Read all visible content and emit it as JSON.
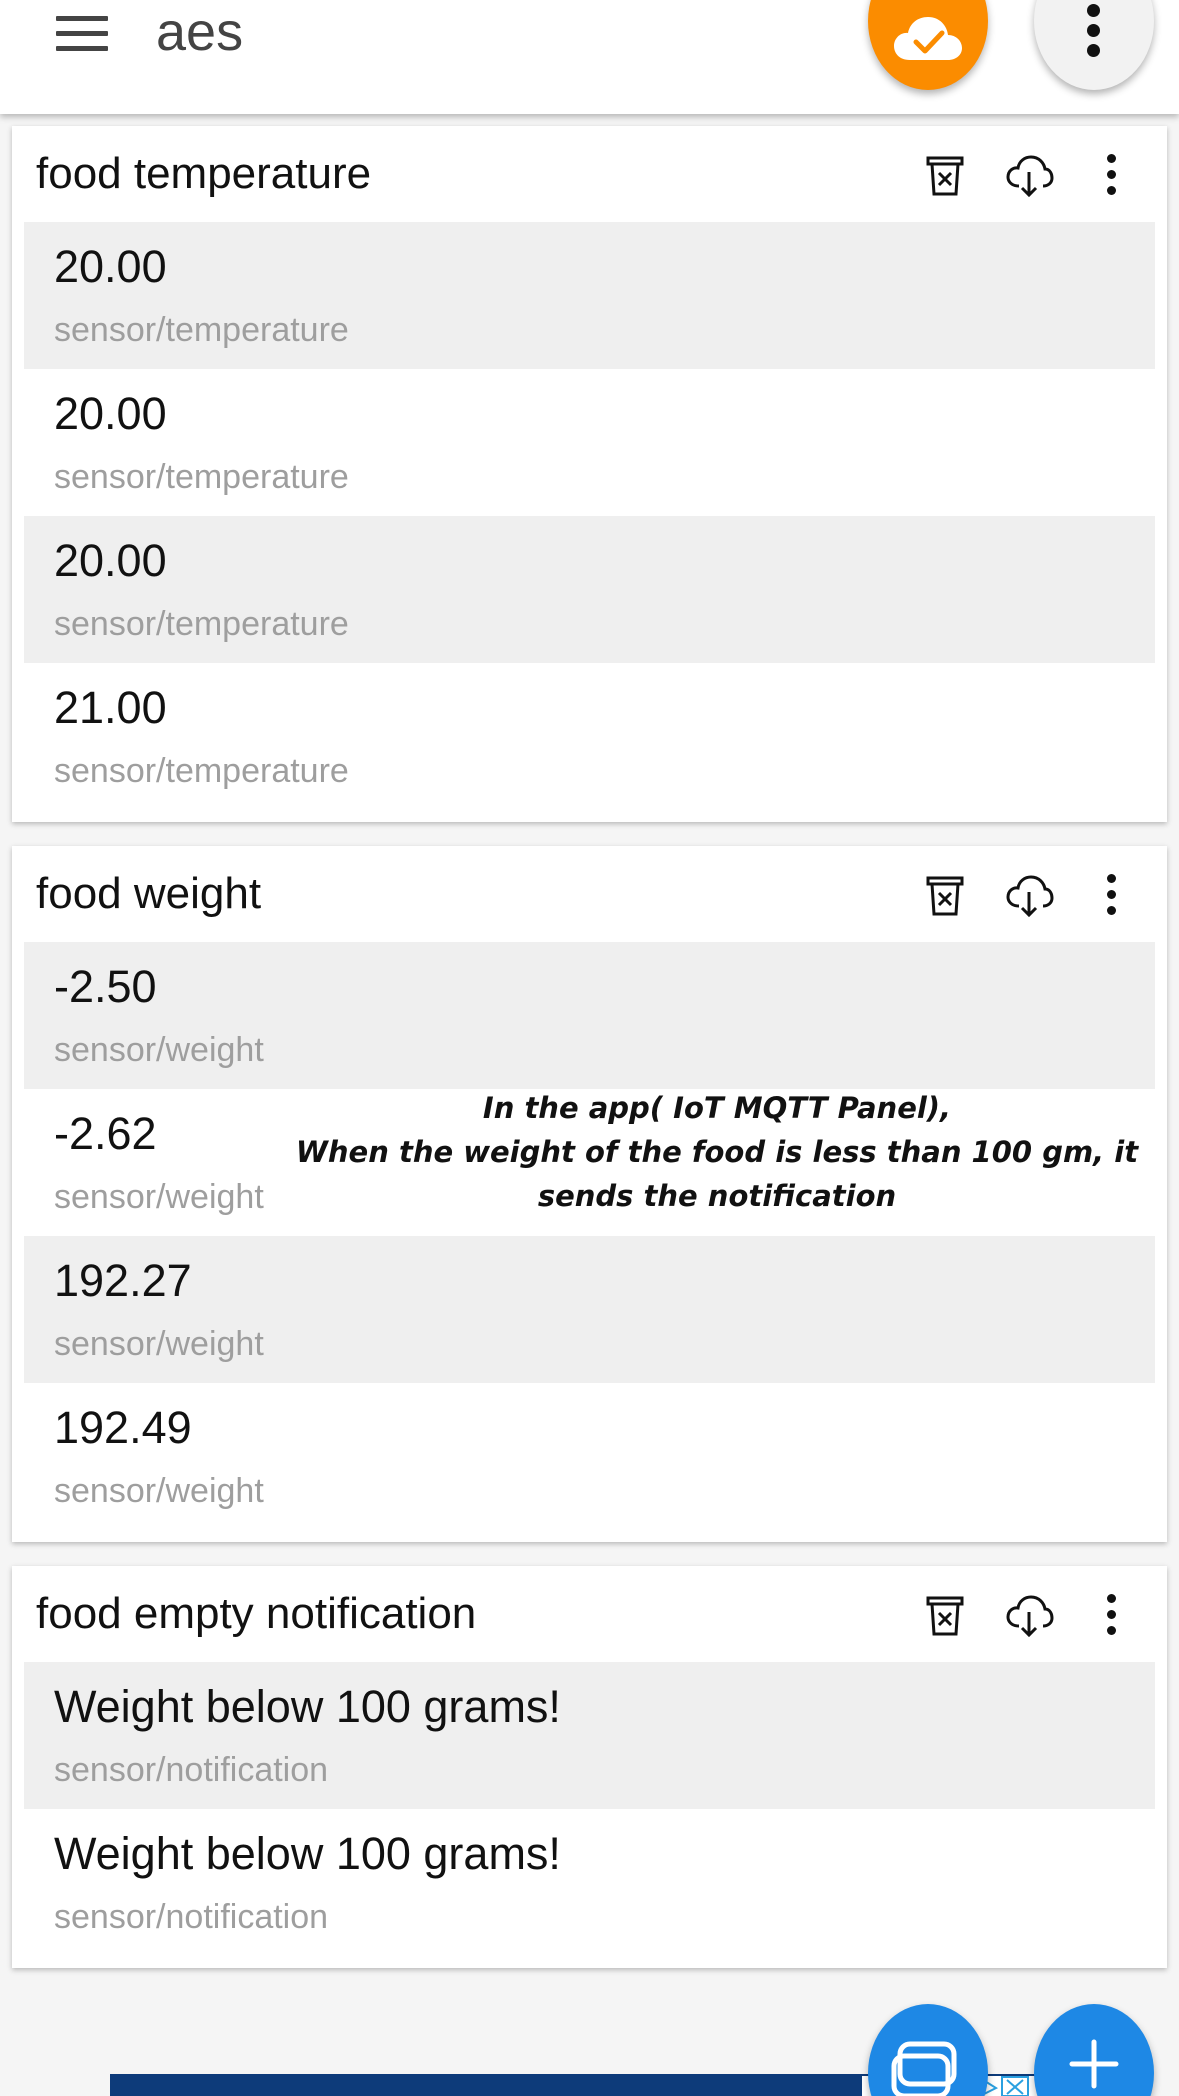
{
  "app": {
    "title": "aes"
  },
  "colors": {
    "accent_orange": "#fb8c00",
    "accent_blue": "#1e88e5",
    "ad_banner": "#0d3b7a",
    "row_shaded": "#efefef",
    "topic_text": "#9e9e9e"
  },
  "icons": {
    "menu": "hamburger-icon",
    "cloud_status": "cloud-check-icon",
    "overflow": "more-vert-icon",
    "clear": "trash-clear-icon",
    "download": "cloud-download-icon",
    "dashboard": "dashboard-icon",
    "add": "plus-icon"
  },
  "panels": [
    {
      "title": "food temperature",
      "rows": [
        {
          "value": "20.00",
          "topic": "sensor/temperature"
        },
        {
          "value": "20.00",
          "topic": "sensor/temperature"
        },
        {
          "value": "20.00",
          "topic": "sensor/temperature"
        },
        {
          "value": "21.00",
          "topic": "sensor/temperature"
        }
      ]
    },
    {
      "title": "food weight",
      "rows": [
        {
          "value": "-2.50",
          "topic": "sensor/weight"
        },
        {
          "value": "-2.62",
          "topic": "sensor/weight"
        },
        {
          "value": "192.27",
          "topic": "sensor/weight"
        },
        {
          "value": "192.49",
          "topic": "sensor/weight"
        }
      ]
    },
    {
      "title": "food empty notification",
      "rows": [
        {
          "value": "Weight below 100 grams!",
          "topic": "sensor/notification"
        },
        {
          "value": "Weight below 100 grams!",
          "topic": "sensor/notification"
        }
      ]
    }
  ],
  "annotation": {
    "line1": "In the app( IoT MQTT Panel),",
    "line2": "When the weight of the food is less than 100 gm, it",
    "line3": "sends the notification"
  }
}
